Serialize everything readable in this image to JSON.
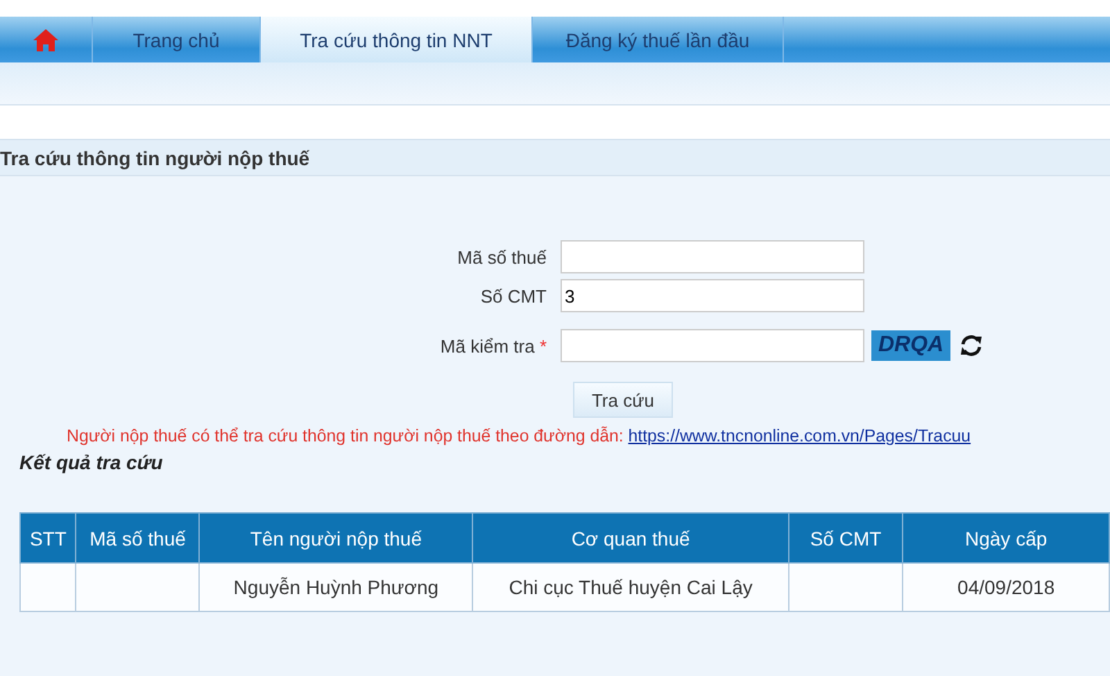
{
  "tabs": [
    {
      "kind": "home",
      "selected": false
    },
    {
      "kind": "text",
      "label": "Trang chủ",
      "selected": false
    },
    {
      "kind": "text",
      "label": "Tra cứu thông tin NNT",
      "selected": true
    },
    {
      "kind": "text",
      "label": "Đăng ký thuế lần đầu",
      "selected": false
    }
  ],
  "section": {
    "title": "Tra cứu thông tin người nộp thuế"
  },
  "form": {
    "fields": [
      {
        "label": "Mã số thuế",
        "required": false
      },
      {
        "label": "Số CMT",
        "value": "3",
        "required": false
      },
      {
        "label": "Mã kiểm tra",
        "required": true,
        "captcha": "DRQA"
      }
    ],
    "required_mark": "*",
    "button": "Tra cứu"
  },
  "notice": {
    "text": "Người nộp thuế có thể tra cứu thông tin người nộp thuế theo đường dẫn:",
    "link": "https://www.tncnonline.com.vn/Pages/Tracuu"
  },
  "results": {
    "title": "Kết quả tra cứu",
    "table": {
      "columns": [
        "STT",
        "Mã số thuế",
        "Tên người nộp thuế",
        "Cơ quan thuế",
        "Số CMT",
        "Ngày cấp"
      ],
      "rows": [
        [
          "",
          "",
          "Nguyễn Huỳnh Phương",
          "Chi cục Thuế huyện Cai Lậy",
          "",
          "04/09/2018"
        ]
      ]
    }
  }
}
